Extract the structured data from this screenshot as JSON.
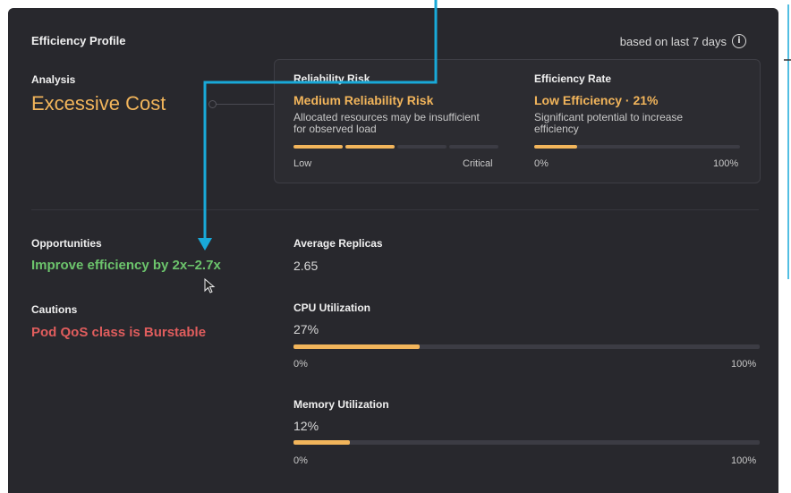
{
  "header": {
    "title": "Efficiency Profile",
    "based_on": "based on last 7 days",
    "info_icon": "info-icon"
  },
  "analysis": {
    "label": "Analysis",
    "value": "Excessive Cost"
  },
  "reliability": {
    "title": "Reliability Risk",
    "value": "Medium Reliability Risk",
    "desc_line1": "Allocated resources may be insufficient",
    "desc_line2": "for observed load",
    "low_label": "Low",
    "high_label": "Critical",
    "segments_filled": 2,
    "segments_total": 4
  },
  "efficiency": {
    "title": "Efficiency Rate",
    "value": "Low Efficiency · 21%",
    "desc_line1": "Significant potential to increase",
    "desc_line2": "efficiency",
    "min_label": "0%",
    "max_label": "100%",
    "percent": 21
  },
  "opportunities": {
    "label": "Opportunities",
    "value": "Improve efficiency by 2x–2.7x"
  },
  "cautions": {
    "label": "Cautions",
    "value": "Pod QoS class is Burstable"
  },
  "metrics": {
    "replicas": {
      "label": "Average Replicas",
      "value": "2.65"
    },
    "cpu": {
      "label": "CPU Utilization",
      "value": "27%",
      "percent": 27,
      "min_label": "0%",
      "max_label": "100%"
    },
    "memory": {
      "label": "Memory Utilization",
      "value": "12%",
      "percent": 12,
      "min_label": "0%",
      "max_label": "100%"
    }
  },
  "colors": {
    "panel_bg": "#28282d",
    "accent_orange": "#f2b55b",
    "opportunity_green": "#6cc46c",
    "caution_red": "#e05d5d",
    "annotation_blue": "#19a9d8",
    "track": "#3c3c44"
  },
  "annotation": {
    "arrow_icon": "annotation-arrow",
    "cursor_icon": "mouse-cursor-icon"
  }
}
